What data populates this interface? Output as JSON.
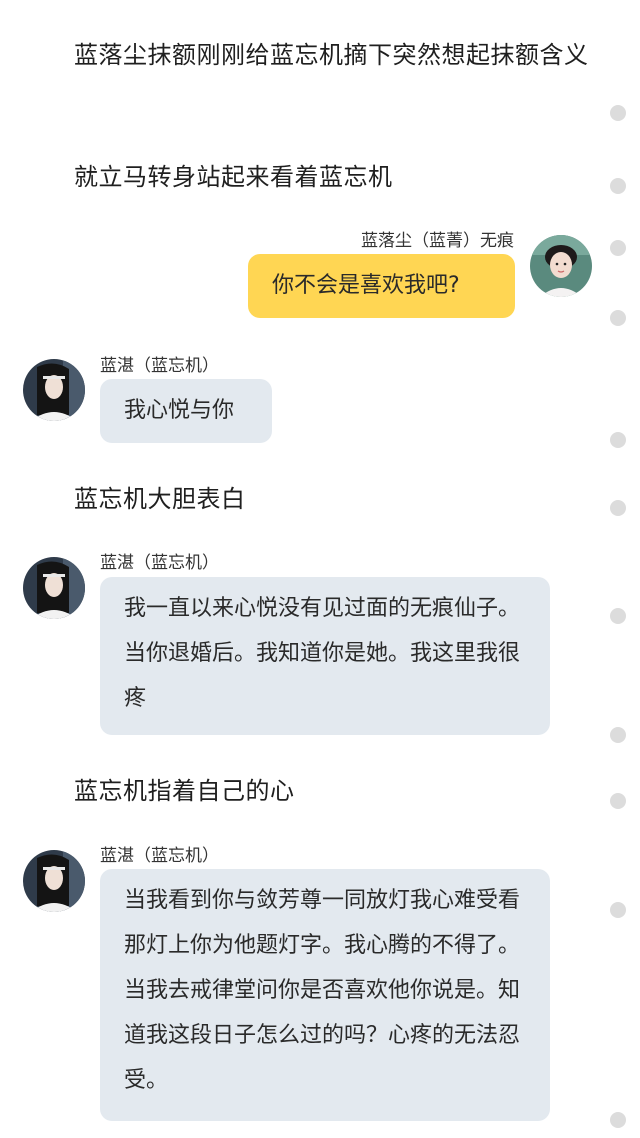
{
  "narrations": [
    "蓝落尘抹额刚刚给蓝忘机摘下突然想起抹额含义",
    "就立马转身站起来看着蓝忘机",
    "蓝忘机大胆表白",
    "蓝忘机指着自己的心"
  ],
  "messages": [
    {
      "sender": "蓝落尘（蓝菁）无痕",
      "text": "你不会是喜欢我吧?"
    },
    {
      "sender": "蓝湛（蓝忘机）",
      "text": "我心悦与你"
    },
    {
      "sender": "蓝湛（蓝忘机）",
      "text": "我一直以来心悦没有见过面的无痕仙子。当你退婚后。我知道你是她。我这里我很疼"
    },
    {
      "sender": "蓝湛（蓝忘机）",
      "text": "当我看到你与敛芳尊一同放灯我心难受看那灯上你为他题灯字。我心腾的不得了。当我去戒律堂问你是否喜欢他你说是。知道我这段日子怎么过的吗？心疼的无法忍受。"
    }
  ],
  "icons": {
    "self_avatar": "female-character-avatar",
    "other_avatar": "male-character-avatar",
    "scroll_markers": "dot-marker"
  },
  "colors": {
    "self_bubble": "#ffd653",
    "other_bubble": "#e3e9ef",
    "background": "#ffffff"
  }
}
